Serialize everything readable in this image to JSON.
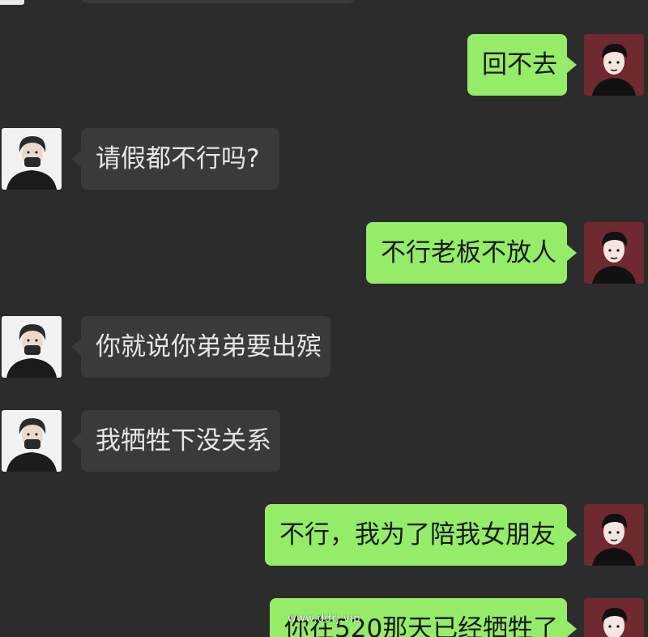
{
  "messages": [
    {
      "side": "out",
      "text": "回不去"
    },
    {
      "side": "in",
      "text": "请假都不行吗?"
    },
    {
      "side": "out",
      "text": "不行老板不放人"
    },
    {
      "side": "in",
      "text": "你就说你弟弟要出殡"
    },
    {
      "side": "in",
      "text": "我牺牲下没关系"
    },
    {
      "side": "out",
      "text": "不行，我为了陪我女朋友"
    },
    {
      "side": "out",
      "text": "你在520那天已经牺牲了"
    }
  ],
  "watermark": "www.ddrj.vip",
  "colors": {
    "background": "#2c2c2c",
    "incoming_bubble": "#3a3a3a",
    "outgoing_bubble": "#95ec69",
    "outgoing_avatar_bg": "#6e2a2e",
    "incoming_avatar_bg": "#f2f2f2"
  },
  "icons": {
    "incoming_avatar": "masked-guy-avatar-icon",
    "outgoing_avatar": "cartoon-guy-avatar-icon"
  }
}
